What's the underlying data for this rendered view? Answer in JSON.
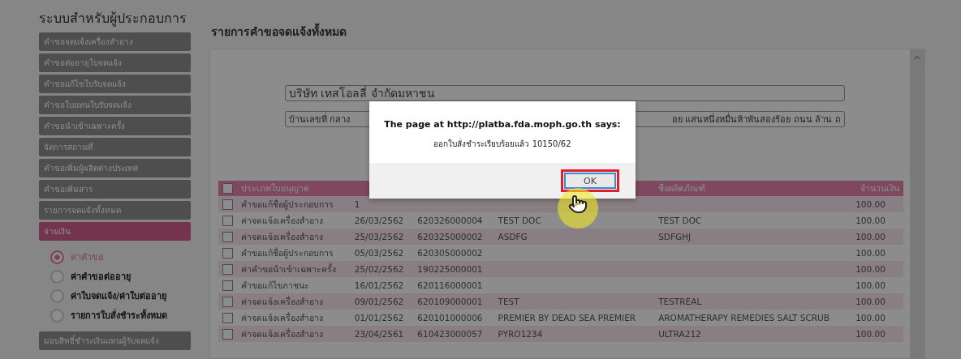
{
  "sidebar": {
    "title": "ระบบสำหรับผู้ประกอบการ",
    "items": [
      {
        "label": "คำขอจดแจ้งเครื่องสำอาง",
        "selected": false
      },
      {
        "label": "คำขอต่ออายุใบจดแจ้ง",
        "selected": false
      },
      {
        "label": "คำขอแก้ไขใบรับจดแจ้ง",
        "selected": false
      },
      {
        "label": "คำขอใบแทนใบรับจดแจ้ง",
        "selected": false
      },
      {
        "label": "คำขอนำเข้าเฉพาะครั้ง",
        "selected": false
      },
      {
        "label": "จัดการสถานที่",
        "selected": false
      },
      {
        "label": "คำขอเพิ่มผู้ผลิตต่างประเทศ",
        "selected": false
      },
      {
        "label": "คำขอเพิ่มสาร",
        "selected": false
      },
      {
        "label": "รายการจดแจ้งทั้งหมด",
        "selected": false
      },
      {
        "label": "จ่ายเงิน",
        "selected": true,
        "children": [
          {
            "label": "ค่าคำขอ",
            "selected": true
          },
          {
            "label": "ค่าคำขอต่ออายุ",
            "selected": false
          },
          {
            "label": "ค่าใบจดแจ้ง/ค่าใบต่ออายุ",
            "selected": false
          },
          {
            "label": "รายการใบสั่งชำระทั้งหมด",
            "selected": false
          }
        ]
      },
      {
        "label": "มอบสิทธิ์ชำระเงินแทนผู้รับจดแจ้ง",
        "selected": false
      }
    ]
  },
  "main": {
    "heading": "รายการคำขอจดแจ้งทั้งหมด",
    "company_field": {
      "value": "บริษัท เทสโอลลี่ จำกัดมหาชน"
    },
    "address_field": {
      "value_parts": [
        "บ้านเลขที่ กลาง",
        "อย แสนหนึ่งหมื่นห้าพันสองร้อย ถนน ล้าน ถ"
      ]
    },
    "table": {
      "select_all_checked": false,
      "columns": [
        {
          "label": "ประเภทใบอนุญาต"
        },
        {},
        {},
        {},
        {
          "label": "ชื่อผลิตภัณฑ์"
        },
        {
          "label": "จำนวนเงิน"
        }
      ],
      "rows": [
        {
          "checked": false,
          "cells": [
            "คำขอแก้ชื่อผู้ประกอบการ",
            "1",
            null,
            null,
            null,
            "100.00"
          ]
        },
        {
          "checked": false,
          "cells": [
            "ค่าจดแจ้งเครื่องสำอาง",
            "26/03/2562",
            "620326000004",
            "TEST DOC",
            "TEST DOC",
            "100.00"
          ]
        },
        {
          "checked": false,
          "cells": [
            "ค่าจดแจ้งเครื่องสำอาง",
            "25/03/2562",
            "620325000002",
            "ASDFG",
            "SDFGHJ",
            "100.00"
          ]
        },
        {
          "checked": false,
          "cells": [
            "คำขอแก้ชื่อผู้ประกอบการ",
            "05/03/2562",
            "620305000002",
            null,
            null,
            "100.00"
          ]
        },
        {
          "checked": false,
          "cells": [
            "ค่าคำขอนำเข้าเฉพาะครั้ง",
            "25/02/2562",
            "190225000001",
            null,
            null,
            "100.00"
          ]
        },
        {
          "checked": false,
          "cells": [
            "คำขอแก้ไขภาชนะ",
            "16/01/2562",
            "620116000001",
            null,
            null,
            "100.00"
          ]
        },
        {
          "checked": false,
          "cells": [
            "ค่าจดแจ้งเครื่องสำอาง",
            "09/01/2562",
            "620109000001",
            "TEST",
            "TESTREAL",
            "100.00"
          ]
        },
        {
          "checked": false,
          "cells": [
            "ค่าจดแจ้งเครื่องสำอาง",
            "01/01/2562",
            "620101000006",
            "PREMIER BY DEAD SEA PREMIER",
            "AROMATHERAPY REMEDIES SALT SCRUB",
            "100.00"
          ]
        },
        {
          "checked": false,
          "cells": [
            "ค่าจดแจ้งเครื่องสำอาง",
            "23/04/2561",
            "610423000057",
            "PYRO1234",
            "ULTRA212",
            "100.00"
          ]
        }
      ]
    }
  },
  "dialog": {
    "title": "The page at http://platba.fda.moph.go.th says:",
    "message": "ออกใบสั่งชำระเรียบร้อยแล้ว 10150/62",
    "ok_button": "OK"
  }
}
